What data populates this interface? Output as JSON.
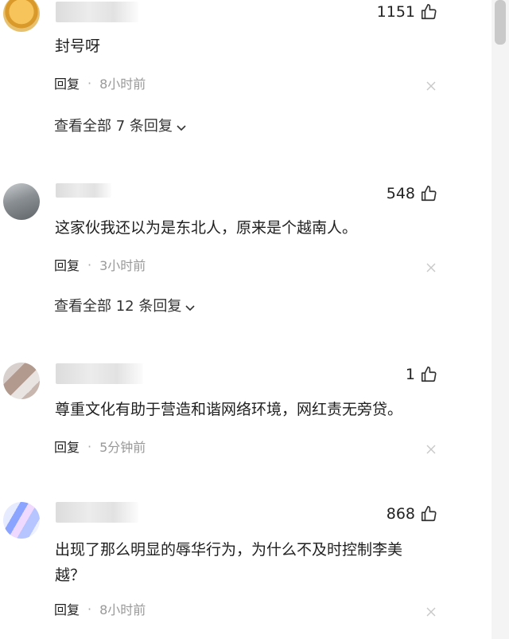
{
  "comments": [
    {
      "likes": "1151",
      "text": "封号呀",
      "reply_label": "回复",
      "separator": "·",
      "time": "8小时前",
      "view_all": "查看全部 7 条回复"
    },
    {
      "likes": "548",
      "text": "这家伙我还以为是东北人，原来是个越南人。",
      "reply_label": "回复",
      "separator": "·",
      "time": "3小时前",
      "view_all": "查看全部 12 条回复"
    },
    {
      "likes": "1",
      "text": "尊重文化有助于营造和谐网络环境，网红责无旁贷。",
      "reply_label": "回复",
      "separator": "·",
      "time": "5分钟前"
    },
    {
      "likes": "868",
      "text_line1": "出现了那么明显的辱华行为，为什么不及时控制李美",
      "text_line2": "越？",
      "reply_label": "回复",
      "separator": "·",
      "time": "8小时前"
    }
  ],
  "icons": {
    "like": "thumbs-up-icon",
    "close": "close-icon",
    "expand": "chevron-down-icon"
  },
  "colors": {
    "text": "#1f1f1f",
    "muted": "#999999",
    "background": "#ffffff"
  }
}
